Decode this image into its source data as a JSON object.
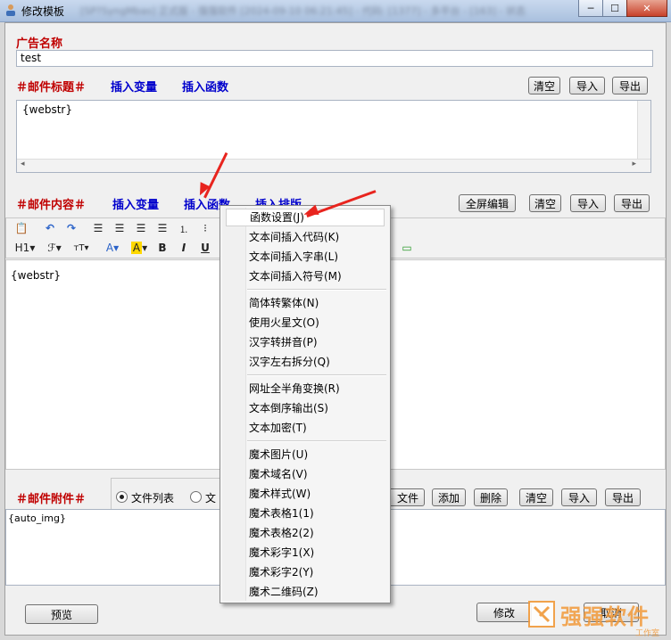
{
  "window": {
    "title": "修改模板",
    "blurred_title_text": "[SP?SyngMbas] 正式版 - 强强软件 [2024-09-10 06:21:45] - 代码: [1377] - 多平台 - [163] - 状态",
    "minimize": "─",
    "maximize": "☐",
    "close": "✕"
  },
  "ad": {
    "label": "广告名称",
    "value": "test"
  },
  "subject": {
    "label": "＃邮件标题＃",
    "insert_variable": "插入变量",
    "insert_function": "插入函数",
    "clear": "清空",
    "import": "导入",
    "export": "导出",
    "content": "{webstr}"
  },
  "body": {
    "label": "＃邮件内容＃",
    "insert_variable": "插入变量",
    "insert_function": "插入函数",
    "insert_layout": "插入排版",
    "fullscreen": "全屏编辑",
    "clear": "清空",
    "import": "导入",
    "export": "导出",
    "content": "{webstr}",
    "toolbar": {
      "heading": "H1",
      "bold": "B",
      "italic": "I",
      "underline": "U"
    }
  },
  "attachment": {
    "label": "＃邮件附件＃",
    "radio_file_list": "文件列表",
    "radio_text_partial": "文",
    "add_file_partial": "文件",
    "add": "添加",
    "delete": "删除",
    "clear": "清空",
    "import": "导入",
    "export": "导出",
    "content": "{auto_img}"
  },
  "footer": {
    "preview": "预览",
    "modify_partial": "修改",
    "cancel_partial": "取消"
  },
  "watermark": {
    "text": "强强软件",
    "subtext": "工作室"
  },
  "menu": {
    "groups": [
      [
        "函数设置(J)",
        "文本间插入代码(K)",
        "文本间插入字串(L)",
        "文本间插入符号(M)"
      ],
      [
        "简体转繁体(N)",
        "使用火星文(O)",
        "汉字转拼音(P)",
        "汉字左右拆分(Q)"
      ],
      [
        "网址全半角变换(R)",
        "文本倒序输出(S)",
        "文本加密(T)"
      ],
      [
        "魔术图片(U)",
        "魔术域名(V)",
        "魔术样式(W)",
        "魔术表格1(1)",
        "魔术表格2(2)",
        "魔术彩字1(X)",
        "魔术彩字2(Y)",
        "魔术二维码(Z)"
      ]
    ]
  },
  "colors": {
    "label_red": "#c00000",
    "link_blue": "#0000cc",
    "arrow_red": "#e8241e"
  }
}
